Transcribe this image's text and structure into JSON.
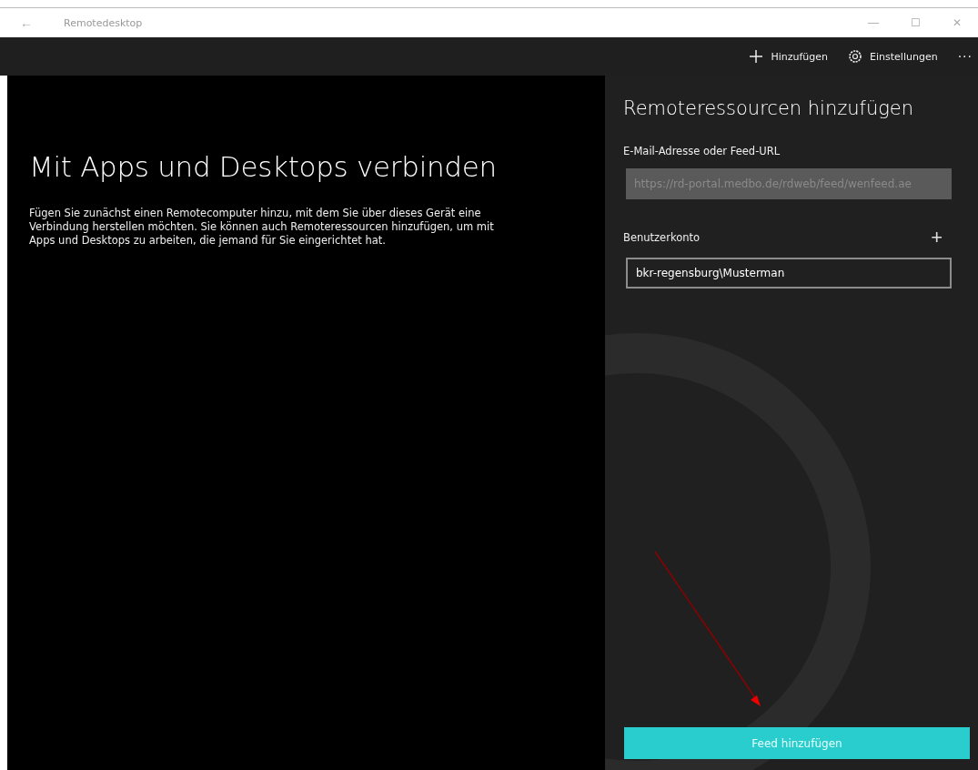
{
  "window": {
    "title": "Remotedesktop",
    "back_glyph": "←",
    "controls": [
      "—",
      "☐",
      "✕"
    ]
  },
  "command_bar": {
    "items": [
      {
        "kind": "add",
        "label": "Hinzufügen"
      },
      {
        "kind": "settings",
        "label": "Einstellungen"
      }
    ],
    "more": "···"
  },
  "intro": {
    "heading": "Mit Apps und Desktops verbinden",
    "text": "Fügen Sie zunächst einen Remotecomputer hinzu, mit dem Sie über dieses Gerät eine Verbindung herstellen möchten. Sie können auch Remoteressourcen hinzufügen, um mit Apps und Desktops zu arbeiten, die jemand für Sie eingerichtet hat."
  },
  "panel": {
    "title": "Remoteressourcen hinzufügen",
    "fields": [
      {
        "label": "E-Mail-Adresse oder Feed-URL",
        "value": "https://rd-portal.medbo.de/rdweb/feed/wenfeed.ae",
        "disabled": true
      },
      {
        "label": "Benutzerkonto",
        "value": "bkr-regensburg\\Musterman",
        "disabled": false,
        "add_glyph": "+"
      }
    ],
    "button": "Feed hinzufügen"
  }
}
